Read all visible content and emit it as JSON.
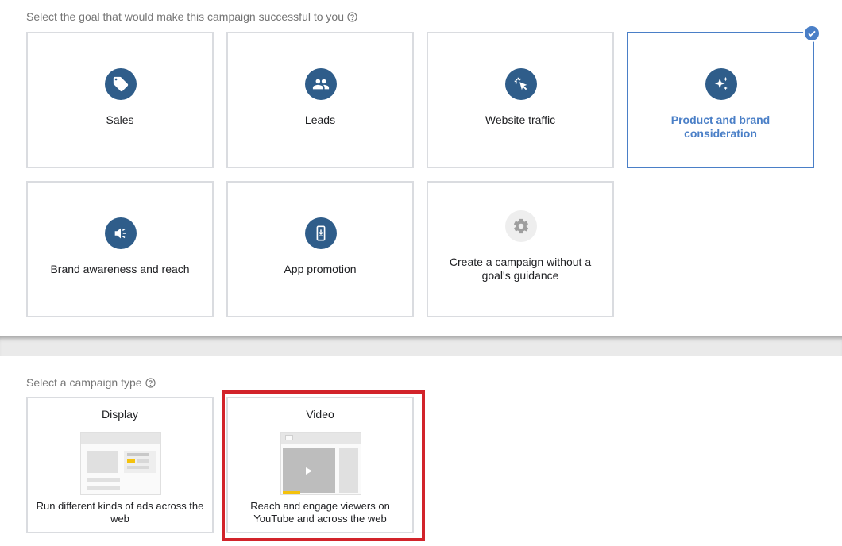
{
  "goals_section": {
    "prompt": "Select the goal that would make this campaign successful to you",
    "goals": [
      {
        "label": "Sales",
        "icon": "tag-icon"
      },
      {
        "label": "Leads",
        "icon": "people-icon"
      },
      {
        "label": "Website traffic",
        "icon": "cursor-click-icon"
      },
      {
        "label": "Product and brand consideration",
        "icon": "sparkle-icon",
        "selected": true
      },
      {
        "label": "Brand awareness and reach",
        "icon": "megaphone-icon"
      },
      {
        "label": "App promotion",
        "icon": "phone-download-icon"
      },
      {
        "label": "Create a campaign without a goal's guidance",
        "icon": "gear-icon"
      }
    ]
  },
  "types_section": {
    "prompt": "Select a campaign type",
    "types": [
      {
        "title": "Display",
        "description": "Run different kinds of ads across the web",
        "illustration": "display-ad-illustration"
      },
      {
        "title": "Video",
        "description": "Reach and engage viewers on YouTube and across the web",
        "illustration": "video-ad-illustration",
        "highlighted": true
      }
    ]
  },
  "colors": {
    "icon_blue": "#2f5d8a",
    "selected_blue": "#4a7fc7",
    "highlight_red": "#d2232a",
    "card_border": "#dadce0",
    "accent_yellow": "#f4c20d"
  }
}
